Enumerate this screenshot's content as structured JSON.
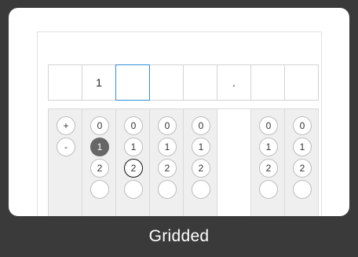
{
  "entry": {
    "cells": [
      "",
      "1",
      "",
      "",
      "",
      ".",
      "",
      ""
    ]
  },
  "grid": {
    "col0": [
      "+",
      "-"
    ],
    "digits": [
      "0",
      "1",
      "2",
      ""
    ],
    "marks": {
      "filled": "1",
      "circled": "2"
    }
  },
  "footer": {
    "label": "Gridded"
  },
  "colors": {
    "background": "#3a3a3a",
    "accent": "#2e8fd6",
    "filled_bubble": "#666666"
  }
}
